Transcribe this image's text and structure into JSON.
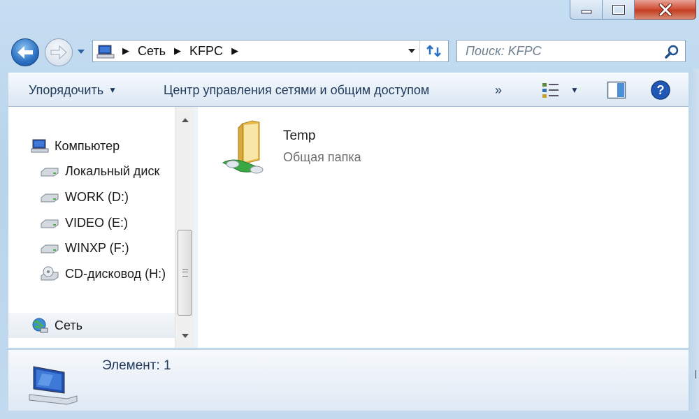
{
  "window": {
    "controls": {
      "minimize": "minimize-icon",
      "maximize": "maximize-icon",
      "close": "close-icon"
    }
  },
  "navigation": {
    "back_icon": "back-arrow-icon",
    "forward_icon": "forward-arrow-icon",
    "recent_icon": "chevron-down-icon",
    "breadcrumb": [
      "Сеть",
      "KFPC"
    ],
    "breadcrumb_root_icon": "network-computer-icon",
    "refresh_icon": "refresh-icon"
  },
  "search": {
    "placeholder": "Поиск: KFPC",
    "icon": "search-icon"
  },
  "toolbar": {
    "organize_label": "Упорядочить",
    "network_center_label": "Центр управления сетями и общим доступом",
    "more_label": "»",
    "views_icon": "views-icon",
    "preview_pane_icon": "preview-pane-icon",
    "help_icon": "help-icon"
  },
  "sidebar": {
    "items": [
      {
        "label": "Компьютер",
        "icon": "computer-icon"
      },
      {
        "label": "Локальный диск",
        "icon": "drive-icon"
      },
      {
        "label": "WORK (D:)",
        "icon": "drive-icon"
      },
      {
        "label": "VIDEO (E:)",
        "icon": "drive-icon"
      },
      {
        "label": "WINXP (F:)",
        "icon": "drive-icon"
      },
      {
        "label": "CD-дисковод (H:)",
        "icon": "cd-drive-icon"
      },
      {
        "label": "Сеть",
        "icon": "network-icon"
      }
    ]
  },
  "content": {
    "items": [
      {
        "name": "Temp",
        "type": "Общая папка",
        "icon": "shared-folder-icon"
      }
    ]
  },
  "details": {
    "count_text": "Элемент: 1",
    "icon": "computer-icon"
  },
  "colors": {
    "accent": "#1e395b",
    "close_button": "#c23d22",
    "selection": "#e6ecf2"
  }
}
